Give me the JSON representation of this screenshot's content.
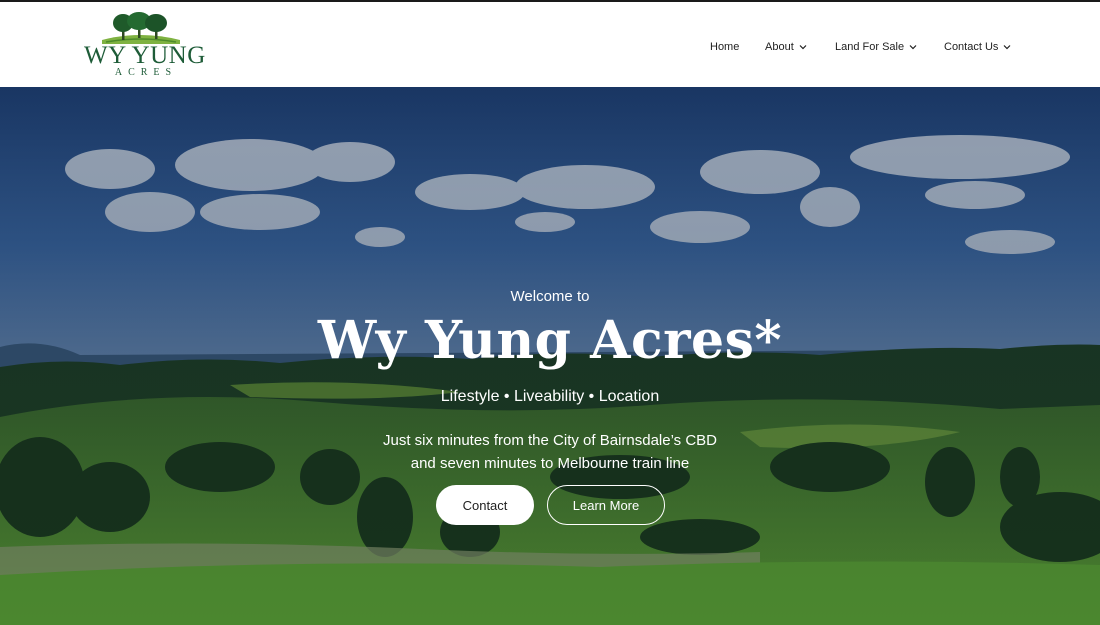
{
  "logo": {
    "name": "WY YUNG",
    "subtitle": "ACRES",
    "brand_color": "#1e5c38",
    "icon": "trees-logo-icon"
  },
  "nav": {
    "items": [
      {
        "label": "Home",
        "has_dropdown": false
      },
      {
        "label": "About",
        "has_dropdown": true
      },
      {
        "label": "Land For Sale",
        "has_dropdown": true
      },
      {
        "label": "Contact Us",
        "has_dropdown": true
      }
    ]
  },
  "hero": {
    "welcome": "Welcome to",
    "title": "Wy Yung Acres*",
    "tagline": "Lifestyle • Liveability • Location",
    "description_line1": "Just six minutes from the City of Bairnsdale’s CBD",
    "description_line2": "and seven minutes to Melbourne train line",
    "buttons": {
      "contact_label": "Contact",
      "learn_more_label": "Learn More"
    },
    "colors": {
      "sky": "#2a4f86",
      "grass": "#4f8a2e",
      "overlay": "#0a1a2e"
    }
  }
}
